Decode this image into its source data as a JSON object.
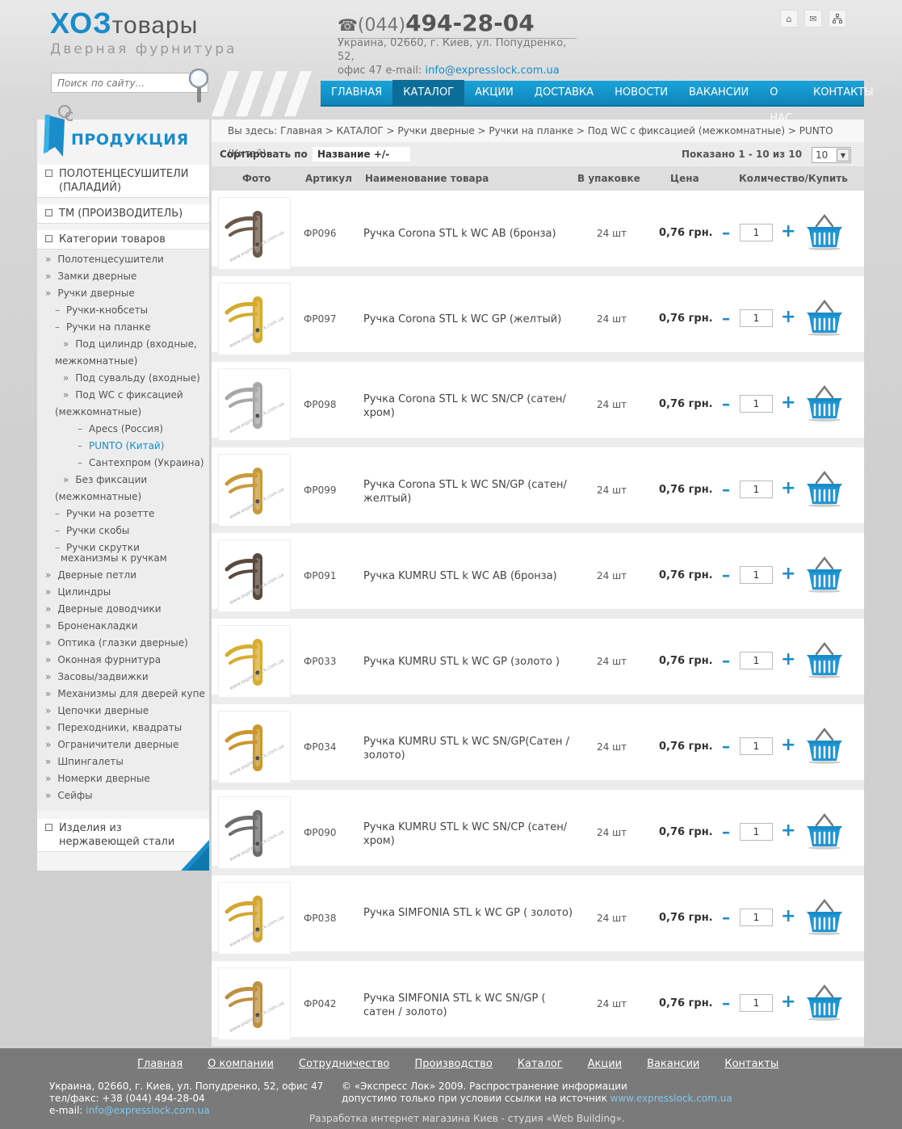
{
  "header": {
    "logo_main": "ХОЗ",
    "logo_main_2": "товары",
    "logo_sub": "Дверная фурнитура",
    "phone_code": "(044)",
    "phone_number": "494-28-04",
    "address_line1": "Украина, 02660, г. Киев, ул. Попудренко, 52,",
    "address_line2": "офис 47 e-mail: ",
    "email": "info@expresslock.com.ua",
    "search_placeholder": "Поиск по сайту..."
  },
  "nav": {
    "items": [
      "ГЛАВНАЯ",
      "КАТАЛОГ",
      "АКЦИИ",
      "ДОСТАВКА",
      "НОВОСТИ",
      "ВАКАНСИИ",
      "О НАС",
      "КОНТАКТЫ"
    ],
    "active": "КАТАЛОГ"
  },
  "sidebar": {
    "title": "ПРОДУКЦИЯ",
    "block1": "ПОЛОТЕНЦЕСУШИТЕЛИ (ПАЛАДИЙ)",
    "block2": "ТМ (ПРОИЗВОДИТЕЛЬ)",
    "block3": "Категории товаров",
    "block4": "Изделия из нержавеющей стали",
    "items": [
      {
        "t": "Полотенцесушители",
        "m": "»",
        "l": 0
      },
      {
        "t": "Замки дверные",
        "m": "»",
        "l": 0
      },
      {
        "t": "Ручки дверные",
        "m": "»",
        "l": 0
      },
      {
        "t": "Ручки-кнобсеты",
        "m": "–",
        "l": 1
      },
      {
        "t": "Ручки на планке",
        "m": "–",
        "l": 1
      },
      {
        "t": "Под цилиндр (входные,",
        "m": "»",
        "l": 2
      },
      {
        "t": "межкомнатные)",
        "m": "",
        "l": 3
      },
      {
        "t": "Под сувальду (входные)",
        "m": "»",
        "l": 2
      },
      {
        "t": "Под WC с фиксацией",
        "m": "»",
        "l": 2
      },
      {
        "t": "(межкомнатные)",
        "m": "",
        "l": 3
      },
      {
        "t": "Apecs (Россия)",
        "m": "–",
        "l": 4
      },
      {
        "t": "PUNTO (Китай)",
        "m": "–",
        "l": 4,
        "active": true
      },
      {
        "t": "Сантехпром (Украина)",
        "m": "–",
        "l": 4
      },
      {
        "t": "Без фиксации",
        "m": "»",
        "l": 2
      },
      {
        "t": "(межкомнатные)",
        "m": "",
        "l": 3
      },
      {
        "t": "Ручки на розетте",
        "m": "–",
        "l": 1
      },
      {
        "t": "Ручки скобы",
        "m": "–",
        "l": 1
      },
      {
        "t": "Ручки скрутки",
        "m": "–",
        "l": 1
      },
      {
        "t": "механизмы к ручкам",
        "m": "",
        "l": 5
      },
      {
        "t": "Дверные петли",
        "m": "»",
        "l": 0
      },
      {
        "t": "Цилиндры",
        "m": "»",
        "l": 0
      },
      {
        "t": "Дверные доводчики",
        "m": "»",
        "l": 0
      },
      {
        "t": "Бронenакладки",
        "m": "»",
        "l": 0
      },
      {
        "t": "Оптика (глазки дверные)",
        "m": "»",
        "l": 0
      },
      {
        "t": "Оконная фурнитура",
        "m": "»",
        "l": 0
      },
      {
        "t": "Засовы/задвижки",
        "m": "»",
        "l": 0
      },
      {
        "t": "Механизмы для дверей купе",
        "m": "»",
        "l": 0
      },
      {
        "t": "Цепочки дверные",
        "m": "»",
        "l": 0
      },
      {
        "t": "Переходники, квадраты",
        "m": "»",
        "l": 0
      },
      {
        "t": "Ограничители дверные",
        "m": "»",
        "l": 0
      },
      {
        "t": "Шпингалеты",
        "m": "»",
        "l": 0
      },
      {
        "t": "Номерки дверные",
        "m": "»",
        "l": 0
      },
      {
        "t": "Сейфы",
        "m": "»",
        "l": 0
      }
    ]
  },
  "breadcrumb": "Вы здесь: Главная > КАТАЛОГ > Ручки дверные > Ручки на планке > Под WC с фиксацией (межкомнатные) > PUNTO (Китай)",
  "sort": {
    "label": "Сортировать по",
    "value": "Название +/-",
    "shown": "Показано 1 - 10 из 10",
    "perpage": "10"
  },
  "table": {
    "headers": {
      "photo": "Фото",
      "sku": "Артикул",
      "name": "Наименование товара",
      "pack": "В упаковке",
      "price": "Цена",
      "qty": "Количество/Купить"
    },
    "rows": [
      {
        "sku": "ФР096",
        "name": "Ручка Corona STL k WC AB (бронза)",
        "pack": "24 шт",
        "price": "0,76 грн.",
        "qty": "1",
        "color": "#6b5a4a"
      },
      {
        "sku": "ФР097",
        "name": "Ручка Corona STL k WC GP (желтый)",
        "pack": "24 шт",
        "price": "0,76 грн.",
        "qty": "1",
        "color": "#d6aa2a"
      },
      {
        "sku": "ФР098",
        "name": "Ручка Corona STL k WC SN/CP (сатен/ хром)",
        "pack": "24 шт",
        "price": "0,76 грн.",
        "qty": "1",
        "color": "#a8a8a8"
      },
      {
        "sku": "ФР099",
        "name": "Ручка Corona STL k WC SN/GP (сатен/ желтый)",
        "pack": "24 шт",
        "price": "0,76 грн.",
        "qty": "1",
        "color": "#c99a3a"
      },
      {
        "sku": "ФР091",
        "name": "Ручка KUMRU STL k WC AB (бронза)",
        "pack": "24 шт",
        "price": "0,76 грн.",
        "qty": "1",
        "color": "#5a4a3e"
      },
      {
        "sku": "ФР033",
        "name": "Ручка KUMRU STL k WC GP (золото )",
        "pack": "24 шт",
        "price": "0,76 грн.",
        "qty": "1",
        "color": "#d8ad30"
      },
      {
        "sku": "ФР034",
        "name": "Ручка KUMRU STL k WC SN/GP(Сатен / золото)",
        "pack": "24 шт",
        "price": "0,76 грн.",
        "qty": "1",
        "color": "#c9972e"
      },
      {
        "sku": "ФР090",
        "name": "Ручка KUMRU STL k WC SN/CP (сатен/ хром)",
        "pack": "24 шт",
        "price": "0,76 грн.",
        "qty": "1",
        "color": "#6e6e6e"
      },
      {
        "sku": "ФР038",
        "name": "Ручка SIMFONIA STL k WC GP ( золото)",
        "pack": "24 шт",
        "price": "0,76 грн.",
        "qty": "1",
        "color": "#d3a634"
      },
      {
        "sku": "ФР042",
        "name": "Ручка SIMFONIA STL k WC SN/GP ( сатен / золото)",
        "pack": "24 шт",
        "price": "0,76 грн.",
        "qty": "1",
        "color": "#bf9042"
      }
    ]
  },
  "footer": {
    "links": [
      "Главная",
      "О компании",
      "Сотрудничество",
      "Производство",
      "Каталог",
      "Акции",
      "Вакансии",
      "Контакты"
    ],
    "addr1": "Украина, 02660, г. Киев, ул. Попудренко, 52, офис 47",
    "addr2": "тел/факс: +38 (044) 494-28-04",
    "addr3_label": "e-mail: ",
    "addr3_email": "info@expresslock.com.ua",
    "copy1": "© «Экспресс Лок» 2009. Распространение информации",
    "copy2": "допустимо только при условии ссылки на источник ",
    "copy2_link": "www.expresslock.com.ua",
    "dev": "Разработка интернет магазина Киев - студия «Web Building»."
  },
  "colors": {
    "accent": "#1a8cc9",
    "nav": "#1aa3d9",
    "footer": "#7a7a7a"
  }
}
